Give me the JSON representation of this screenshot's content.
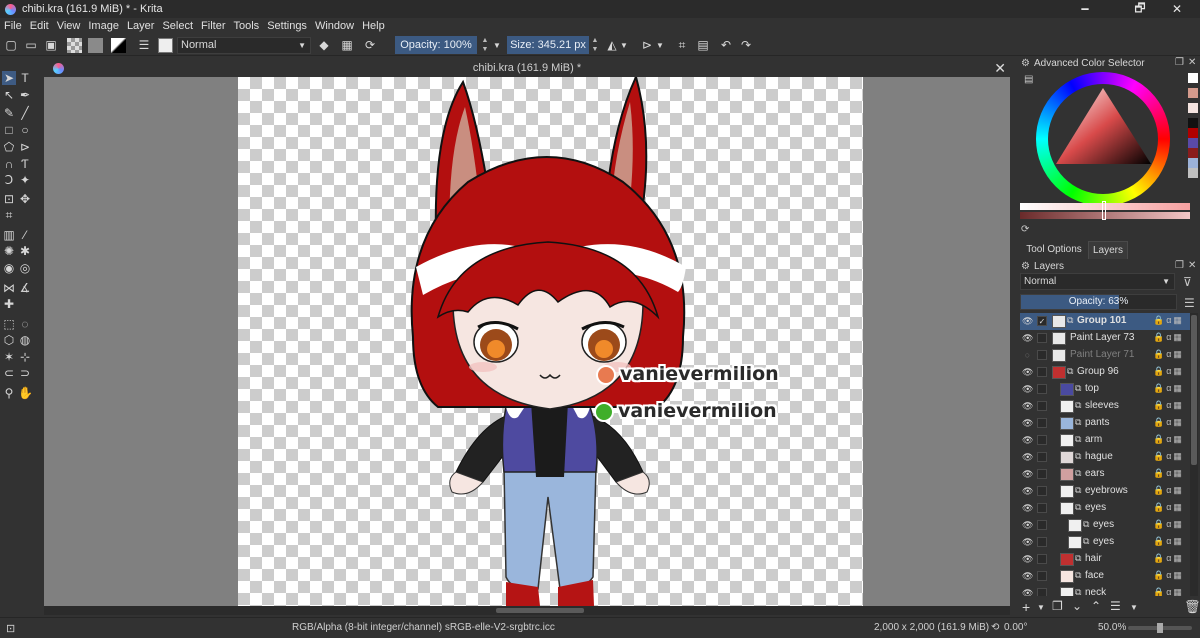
{
  "window": {
    "title": "chibi.kra (161.9 MiB) * - Krita",
    "minimize": "🗕",
    "maximize": "🗗",
    "close": "✕"
  },
  "menu": [
    "File",
    "Edit",
    "View",
    "Image",
    "Layer",
    "Select",
    "Filter",
    "Tools",
    "Settings",
    "Window",
    "Help"
  ],
  "toolbar": {
    "blend_mode": "Normal",
    "opacity_label": "Opacity: 100%",
    "size_label": "Size: 345.21 px"
  },
  "document": {
    "tab_title": "chibi.kra (161.9 MiB) *",
    "close": "✕",
    "watermark_1": "vanievermilion",
    "watermark_2": "vanievermilion"
  },
  "colors": {
    "accent": "#3c5a82",
    "hair_red": "#b30f0f",
    "skin": "#f6e6e1"
  },
  "color_selector": {
    "title": "Advanced Color Selector",
    "palette": [
      "#ffffff",
      "#d49a8c",
      "#f4e4e0",
      "#111111",
      "#b00000",
      "#5a4aa8",
      "#8a1c1c",
      "#9cb2d8",
      "#c0c0c0"
    ]
  },
  "dock_tabs": [
    "Tool Options",
    "Layers"
  ],
  "layers_panel": {
    "title": "Layers",
    "blend_mode": "Normal",
    "opacity_label": "Opacity:  63%",
    "opacity_value": 0.63,
    "layers": [
      {
        "name": "Group 101",
        "type": "group",
        "selected": true,
        "visible": true,
        "checked": true,
        "indent": 0
      },
      {
        "name": "Paint Layer 73",
        "type": "paint",
        "selected": false,
        "visible": true,
        "checked": false,
        "indent": 0
      },
      {
        "name": "Paint Layer 71",
        "type": "paint",
        "selected": false,
        "visible": false,
        "checked": false,
        "indent": 0
      },
      {
        "name": "Group 96",
        "type": "group",
        "selected": false,
        "visible": true,
        "checked": false,
        "indent": 0
      },
      {
        "name": "top",
        "type": "group",
        "selected": false,
        "visible": true,
        "checked": false,
        "indent": 1
      },
      {
        "name": "sleeves",
        "type": "group",
        "selected": false,
        "visible": true,
        "checked": false,
        "indent": 1
      },
      {
        "name": "pants",
        "type": "group",
        "selected": false,
        "visible": true,
        "checked": false,
        "indent": 1
      },
      {
        "name": "arm",
        "type": "group",
        "selected": false,
        "visible": true,
        "checked": false,
        "indent": 1
      },
      {
        "name": "hague",
        "type": "group",
        "selected": false,
        "visible": true,
        "checked": false,
        "indent": 1
      },
      {
        "name": "ears",
        "type": "group",
        "selected": false,
        "visible": true,
        "checked": false,
        "indent": 1
      },
      {
        "name": "eyebrows",
        "type": "group",
        "selected": false,
        "visible": true,
        "checked": false,
        "indent": 1
      },
      {
        "name": "eyes",
        "type": "group",
        "selected": false,
        "visible": true,
        "checked": false,
        "indent": 1
      },
      {
        "name": "eyes",
        "type": "group",
        "selected": false,
        "visible": true,
        "checked": false,
        "indent": 2
      },
      {
        "name": "eyes",
        "type": "group",
        "selected": false,
        "visible": true,
        "checked": false,
        "indent": 2
      },
      {
        "name": "hair",
        "type": "group",
        "selected": false,
        "visible": true,
        "checked": false,
        "indent": 1
      },
      {
        "name": "face",
        "type": "group",
        "selected": false,
        "visible": true,
        "checked": false,
        "indent": 1
      },
      {
        "name": "neck",
        "type": "group",
        "selected": false,
        "visible": true,
        "checked": false,
        "indent": 1
      }
    ]
  },
  "status": {
    "color_space": "RGB/Alpha (8-bit integer/channel)  sRGB-elle-V2-srgbtrc.icc",
    "doc_size": "2,000 x 2,000 (161.9 MiB)",
    "rotation": "0.00°",
    "zoom": "50.0%"
  }
}
